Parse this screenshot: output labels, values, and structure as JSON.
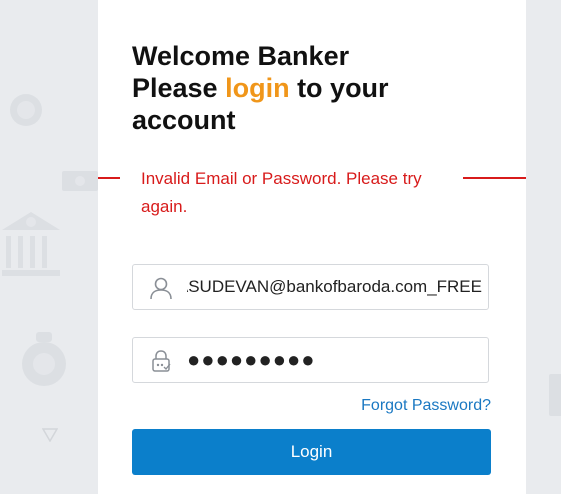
{
  "login_card": {
    "title_line1": "Welcome Banker",
    "title_please": "Please ",
    "title_login_word": "login",
    "title_rest": " to your",
    "title_line3": "account",
    "error_message": "Invalid Email or Password. Please try again.",
    "email_value": "VASUDEVAN@bankofbaroda.com_FREE",
    "password_value": "●●●●●●●●●",
    "forgot_password": "Forgot Password?",
    "login_button": "Login"
  },
  "icons": {
    "user": "user-icon",
    "lock": "lock-icon"
  },
  "colors": {
    "accent": "#f0961a",
    "error": "#d81b1b",
    "primary": "#0b7fcb",
    "link": "#1a78c2"
  }
}
